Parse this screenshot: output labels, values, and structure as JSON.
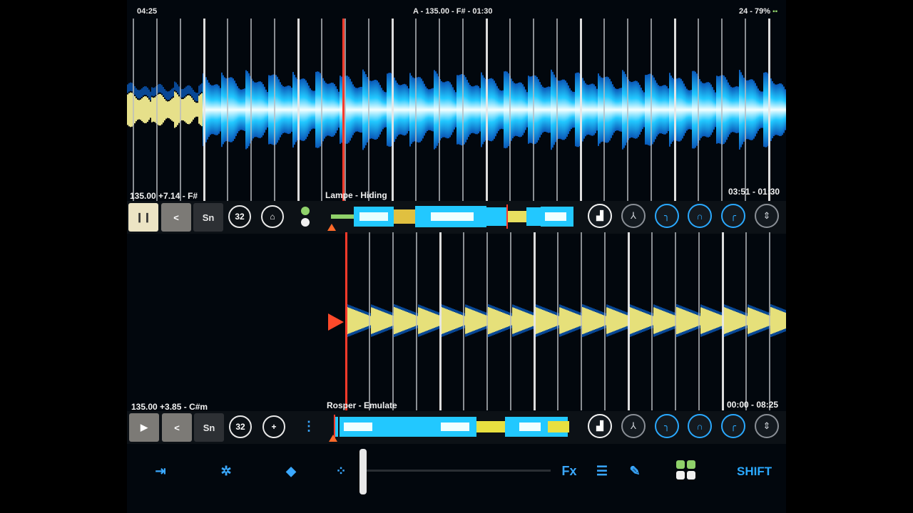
{
  "status": {
    "clock": "04:25",
    "deck_summary": "A - 135.00 - F# - 01:30",
    "battery": "24 - 79%"
  },
  "deck_a": {
    "info_left": "135.00 +7.14 - F#",
    "track": "Lampe - Hiding",
    "time": "03:51 - 01:30",
    "play_state": "pause",
    "back_label": "<",
    "snap_label": "Sn",
    "loop_size": "32",
    "home_icon": "home-icon",
    "knob_icons": [
      "bars-icon",
      "stem-icon",
      "curve-icon",
      "arch-icon",
      "curve-up-icon",
      "updown-icon"
    ]
  },
  "deck_b": {
    "info_left": "135.00 +3.85 - C#m",
    "track": "Rosper - Emulate",
    "time": "00:00 - 08:25",
    "play_state": "play",
    "back_label": "<",
    "snap_label": "Sn",
    "loop_size": "32",
    "add_label": "+",
    "more_label": "⋮",
    "knob_icons": [
      "bars-icon",
      "stem-icon",
      "curve-icon",
      "arch-icon",
      "curve-up-icon",
      "updown-icon"
    ]
  },
  "toolbar": {
    "fx_label": "Fx",
    "shift_label": "SHIFT"
  },
  "crossfader_level": 0.0,
  "colors": {
    "accent_blue": "#2aa9ff",
    "playhead_red": "#ff3a2a",
    "wave_cyan": "#1ec8ff",
    "wave_yellow": "#e8e07a",
    "led_green": "#8fd16a"
  }
}
